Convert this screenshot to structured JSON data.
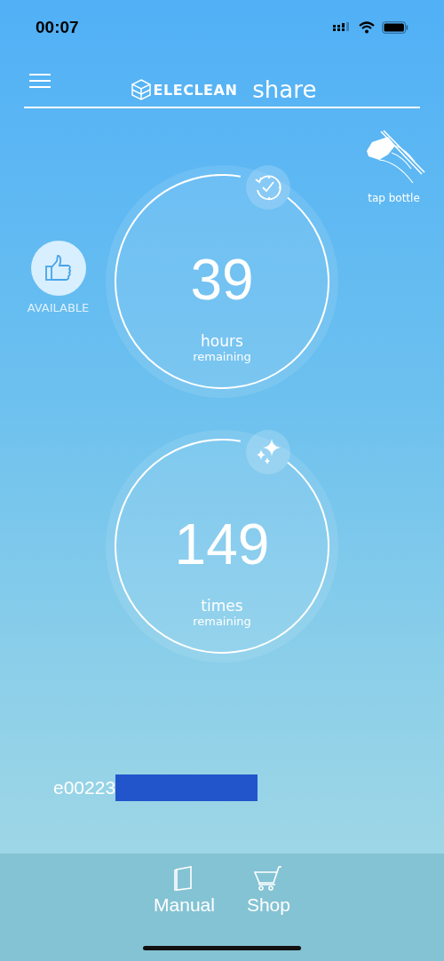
{
  "status_bar": {
    "time": "00:07"
  },
  "header": {
    "brand": "ELECLEAN",
    "title": "share"
  },
  "availability": {
    "label": "AVAILABLE"
  },
  "tap_hint": {
    "label": "tap bottle"
  },
  "counters": [
    {
      "kind": "hours",
      "value": "39",
      "unit": "hours",
      "caption": "remaining"
    },
    {
      "kind": "uses",
      "value": "149",
      "unit": "times",
      "caption": "remaining"
    }
  ],
  "device_id": "e00223",
  "bottom_nav": [
    {
      "kind": "manual",
      "label": "Manual"
    },
    {
      "kind": "shop",
      "label": "Shop"
    }
  ]
}
